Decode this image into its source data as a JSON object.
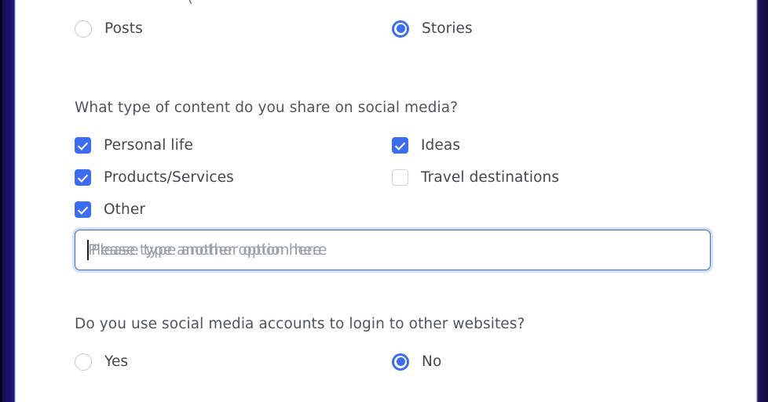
{
  "theme": {
    "accent_blue": "#3c6df0",
    "side_band_navy": "#1a1166",
    "question_text": "#4d5560",
    "option_text": "#42484f",
    "placeholder_text": "#9aa0a8",
    "input_focus_border": "#3f6bb8",
    "unchecked_border": "#cfd2d6"
  },
  "form": {
    "question_media_type": {
      "options": [
        {
          "label": "Posts",
          "selected": false,
          "name": "radio-posts"
        },
        {
          "label": "Stories",
          "selected": true,
          "name": "radio-stories"
        }
      ]
    },
    "question_content_type": {
      "text": "What type of content do you share on social media?",
      "options": [
        {
          "label": "Personal life",
          "checked": true,
          "name": "checkbox-personal-life"
        },
        {
          "label": "Ideas",
          "checked": true,
          "name": "checkbox-ideas"
        },
        {
          "label": "Products/Services",
          "checked": true,
          "name": "checkbox-products-services"
        },
        {
          "label": "Travel destinations",
          "checked": false,
          "name": "checkbox-travel-destinations"
        },
        {
          "label": "Other",
          "checked": true,
          "name": "checkbox-other"
        }
      ],
      "other_input": {
        "value": "",
        "placeholder": "Please type another option here",
        "focused": true,
        "caret_visible": true
      }
    },
    "question_social_login": {
      "text": "Do you use social media accounts to login to other websites?",
      "options": [
        {
          "label": "Yes",
          "selected": false,
          "name": "radio-yes"
        },
        {
          "label": "No",
          "selected": true,
          "name": "radio-no"
        }
      ]
    }
  }
}
